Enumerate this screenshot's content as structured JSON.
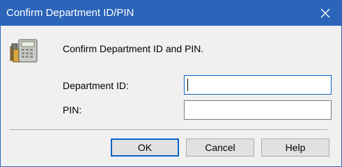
{
  "window": {
    "title": "Confirm Department ID/PIN",
    "close_icon": "close-icon"
  },
  "content": {
    "icon": "calculator-icon",
    "intro": "Confirm Department ID and PIN."
  },
  "fields": {
    "department_id": {
      "label": "Department ID:",
      "value": ""
    },
    "pin": {
      "label": "PIN:",
      "value": ""
    }
  },
  "buttons": {
    "ok": "OK",
    "cancel": "Cancel",
    "help": "Help"
  },
  "colors": {
    "titlebar": "#2b64b8",
    "dialog_bg": "#f0f0f0",
    "focus_border": "#0a64c8"
  }
}
